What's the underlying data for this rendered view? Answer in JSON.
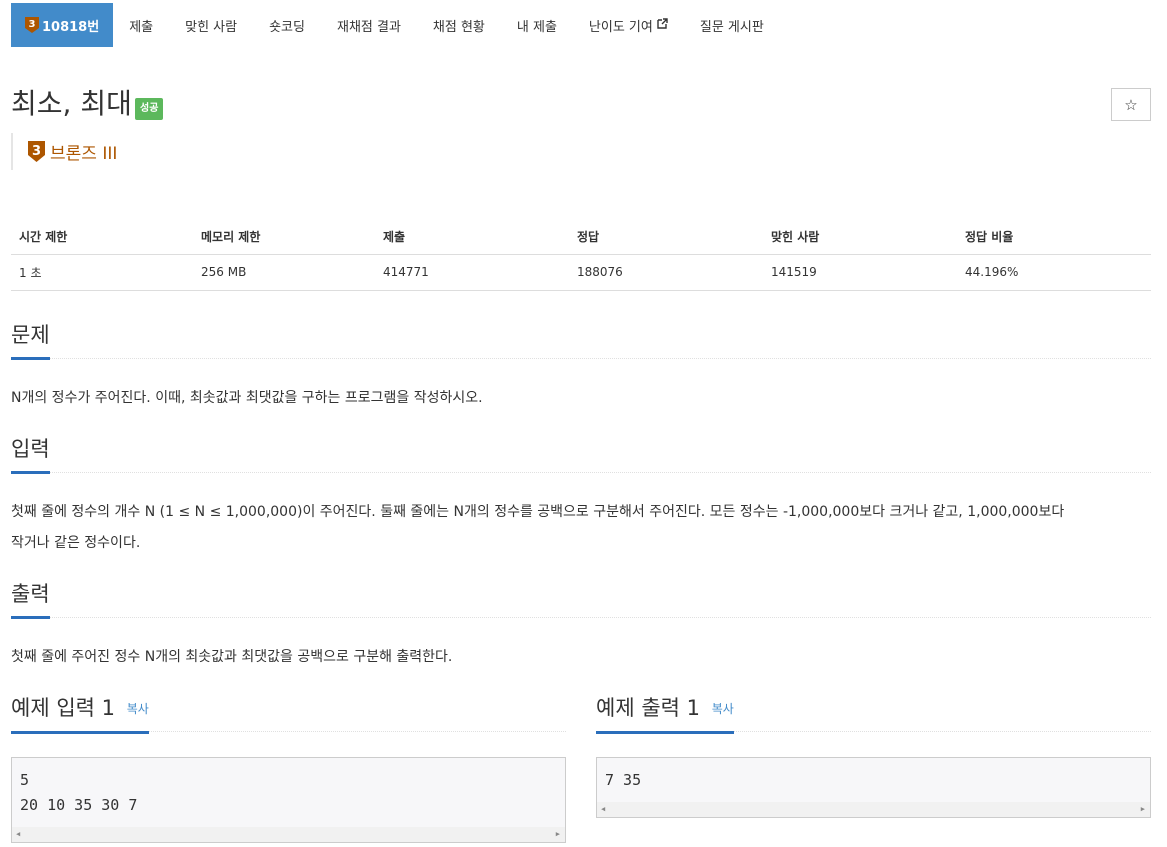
{
  "nav": {
    "problem_tab": {
      "tier_number": "3",
      "label": "10818번"
    },
    "items": [
      "제출",
      "맞힌 사람",
      "숏코딩",
      "재채점 결과",
      "채점 현황",
      "내 제출",
      "난이도 기여",
      "질문 게시판"
    ]
  },
  "problem": {
    "title": "최소, 최대",
    "status_badge": "성공",
    "star_icon": "☆",
    "tier": {
      "number": "3",
      "name": "브론즈 III",
      "color": "#ad5600"
    }
  },
  "info_table": {
    "headers": [
      "시간 제한",
      "메모리 제한",
      "제출",
      "정답",
      "맞힌 사람",
      "정답 비율"
    ],
    "row": [
      "1 초",
      "256 MB",
      "414771",
      "188076",
      "141519",
      "44.196%"
    ]
  },
  "sections": {
    "description": {
      "heading": "문제",
      "text": "N개의 정수가 주어진다. 이때, 최솟값과 최댓값을 구하는 프로그램을 작성하시오."
    },
    "input": {
      "heading": "입력",
      "line1": "첫째 줄에 정수의 개수 N (1 ≤ N ≤ 1,000,000)이 주어진다. 둘째 줄에는 N개의 정수를 공백으로 구분해서 주어진다. 모든 정수는 -1,000,000보다 크거나 같고, 1,000,000보다",
      "line2": "작거나 같은 정수이다."
    },
    "output": {
      "heading": "출력",
      "text": "첫째 줄에 주어진 정수 N개의 최솟값과 최댓값을 공백으로 구분해 출력한다."
    }
  },
  "samples": {
    "input": {
      "heading": "예제 입력 1",
      "copy": "복사",
      "content": "5\n20 10 35 30 7"
    },
    "output": {
      "heading": "예제 출력 1",
      "copy": "복사",
      "content": "7 35"
    }
  },
  "colors": {
    "nav_active": "#428bca",
    "success": "#5cb85c",
    "bronze": "#ad5600",
    "heading_underline": "#2a6ebb"
  }
}
